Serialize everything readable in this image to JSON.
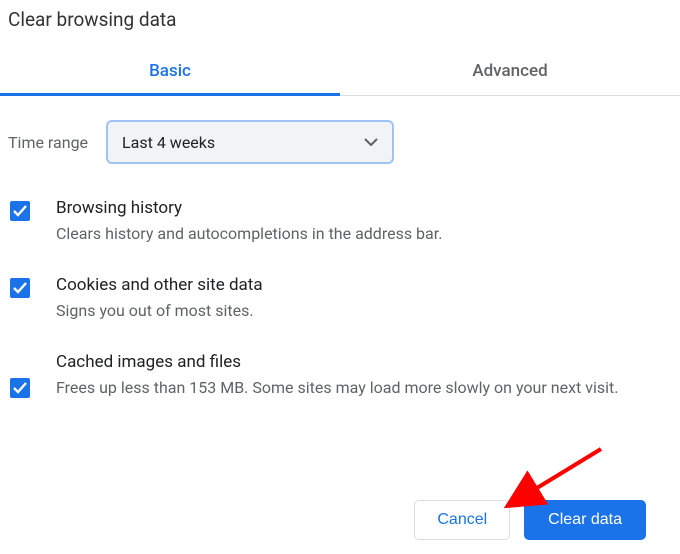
{
  "title": "Clear browsing data",
  "tabs": {
    "basic": "Basic",
    "advanced": "Advanced"
  },
  "time_range": {
    "label": "Time range",
    "value": "Last 4 weeks"
  },
  "options": [
    {
      "title": "Browsing history",
      "desc": "Clears history and autocompletions in the address bar.",
      "checked": true
    },
    {
      "title": "Cookies and other site data",
      "desc": "Signs you out of most sites.",
      "checked": true
    },
    {
      "title": "Cached images and files",
      "desc": "Frees up less than 153 MB. Some sites may load more slowly on your next visit.",
      "checked": true
    }
  ],
  "buttons": {
    "cancel": "Cancel",
    "clear": "Clear data"
  }
}
